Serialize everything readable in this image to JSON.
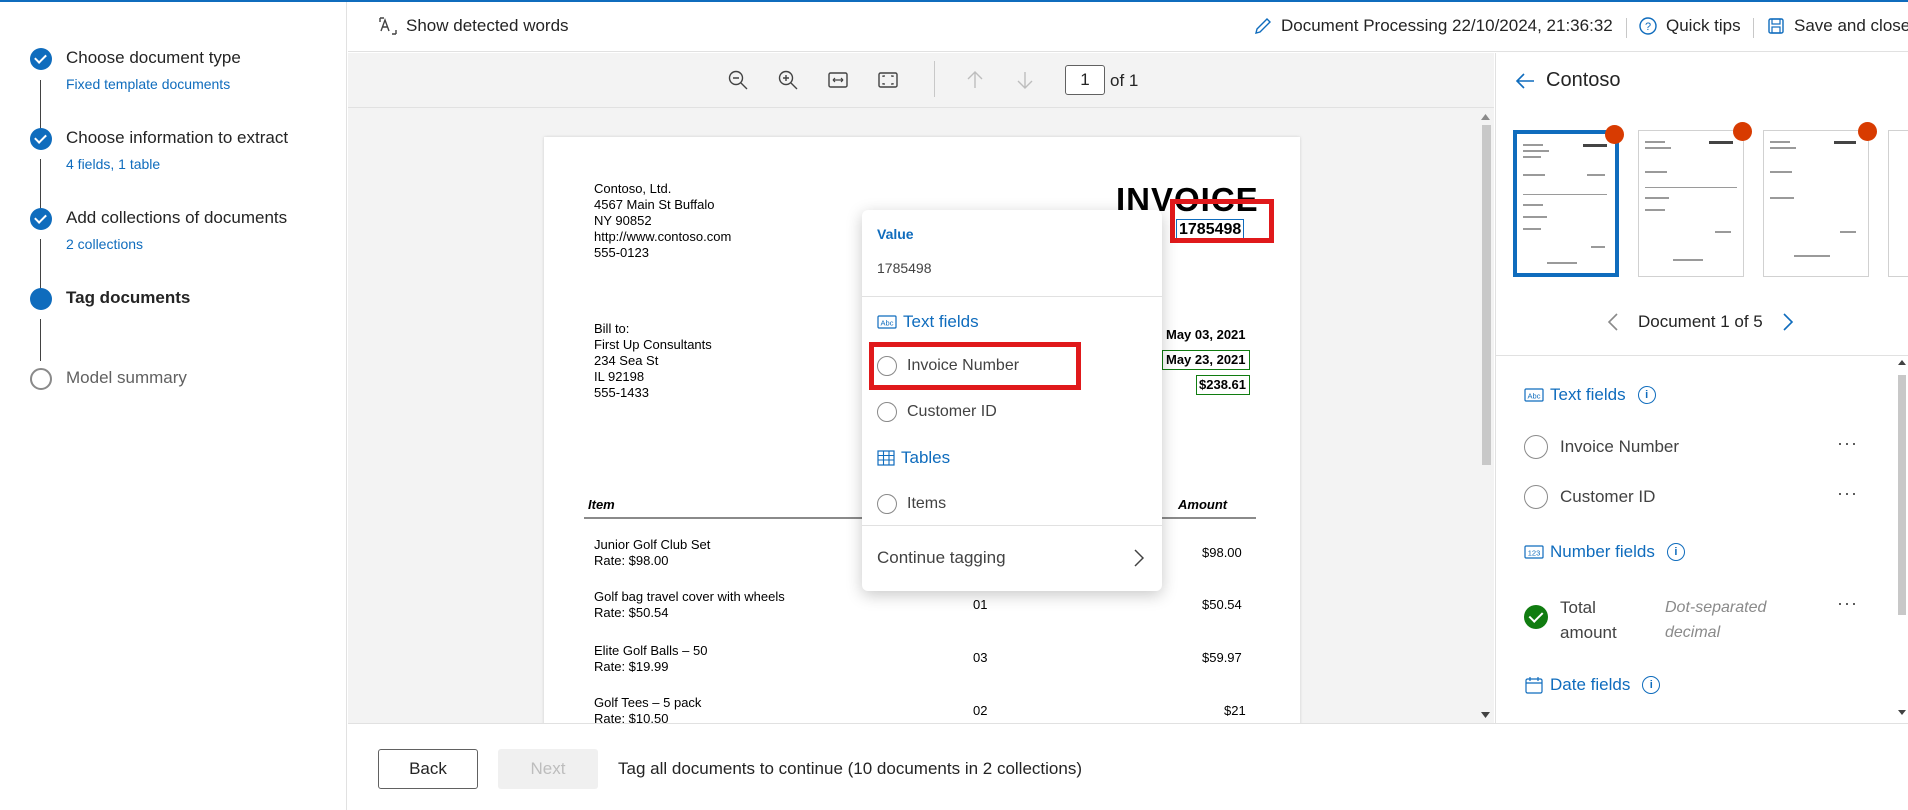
{
  "wizard": {
    "steps": [
      {
        "title": "Choose document type",
        "sub": "Fixed template documents",
        "state": "done"
      },
      {
        "title": "Choose information to extract",
        "sub": "4 fields, 1 table",
        "state": "done"
      },
      {
        "title": "Add collections of documents",
        "sub": "2 collections",
        "state": "done"
      },
      {
        "title": "Tag documents",
        "sub": "",
        "state": "current"
      },
      {
        "title": "Model summary",
        "sub": "",
        "state": "todo"
      }
    ]
  },
  "toolbar": {
    "show_words": "Show detected words",
    "doc_status": "Document Processing 22/10/2024, 21:36:32",
    "quick_tips": "Quick tips",
    "save_close": "Save and close"
  },
  "viewer": {
    "page_number": "1",
    "page_of": "of 1"
  },
  "invoice": {
    "company": [
      "Contoso, Ltd.",
      "4567 Main St Buffalo",
      "NY 90852",
      "http://www.contoso.com",
      "555-0123"
    ],
    "title": "INVOICE",
    "number": "1785498",
    "bill_to": [
      "Bill to:",
      "First Up Consultants",
      "234 Sea St",
      "IL 92198",
      "555-1433"
    ],
    "date1": "May 03, 2021",
    "date2": "May 23, 2021",
    "total": "$238.61",
    "col_item": "Item",
    "col_amount": "Amount",
    "rows": [
      {
        "name": "Junior Golf Club Set",
        "rate": "Rate: $98.00",
        "qty": "",
        "amount": "$98.00"
      },
      {
        "name": "Golf bag travel cover with wheels",
        "rate": "Rate: $50.54",
        "qty": "01",
        "amount": "$50.54"
      },
      {
        "name": "Elite Golf Balls – 50",
        "rate": "Rate: $19.99",
        "qty": "03",
        "amount": "$59.97"
      },
      {
        "name": "Golf Tees – 5 pack",
        "rate": "Rate: $10.50",
        "qty": "02",
        "amount": "$21"
      }
    ]
  },
  "popup": {
    "value_label": "Value",
    "value": "1785498",
    "text_fields": "Text fields",
    "invoice_number": "Invoice Number",
    "customer_id": "Customer ID",
    "tables": "Tables",
    "items": "Items",
    "continue": "Continue tagging"
  },
  "right_panel": {
    "collection": "Contoso",
    "doc_nav": "Document 1 of 5",
    "text_fields": "Text fields",
    "invoice_number": "Invoice Number",
    "customer_id": "Customer ID",
    "number_fields": "Number fields",
    "total_amount_1": "Total",
    "total_amount_2": "amount",
    "total_hint_1": "Dot-separated",
    "total_hint_2": "decimal",
    "date_fields": "Date fields",
    "more": "···"
  },
  "footer": {
    "back": "Back",
    "next": "Next",
    "message": "Tag all documents to continue (10 documents in 2 collections)"
  },
  "colors": {
    "accent": "#0f6cbd",
    "highlight": "#e0191b",
    "success": "#107c10",
    "badge": "#d83b01"
  },
  "icons": [
    "detect-words-icon",
    "pencil-icon",
    "help-icon",
    "save-icon",
    "zoom-out-icon",
    "zoom-in-icon",
    "fit-width-icon",
    "fit-page-icon",
    "arrow-up-icon",
    "arrow-down-icon",
    "arrow-left-icon",
    "chevron-left-icon",
    "chevron-right-icon",
    "info-icon",
    "table-icon",
    "text-field-icon",
    "number-field-icon",
    "calendar-icon"
  ]
}
